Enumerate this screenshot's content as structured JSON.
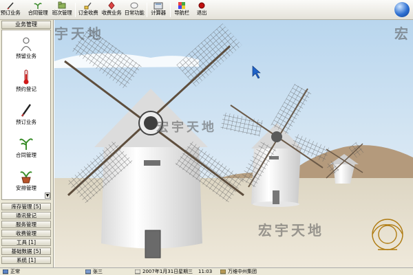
{
  "toolbar": {
    "items": [
      {
        "label": "预订业务",
        "icon": "pen-icon"
      },
      {
        "label": "合同管理",
        "icon": "plant-icon"
      },
      {
        "label": "班次管理",
        "icon": "folder-icon"
      },
      {
        "label": "订金收费",
        "icon": "payment-icon"
      },
      {
        "label": "收费业务",
        "icon": "cash-icon"
      },
      {
        "label": "日常功能",
        "icon": "balloon-icon"
      },
      {
        "label": "计算器",
        "icon": "calculator-icon"
      },
      {
        "label": "导航栏",
        "icon": "navigator-icon"
      },
      {
        "label": "退出",
        "icon": "exit-icon"
      }
    ]
  },
  "sidebar": {
    "header": "业务管理",
    "items": [
      {
        "label": "预留业务",
        "icon": "person-icon"
      },
      {
        "label": "预约登记",
        "icon": "thermometer-icon"
      },
      {
        "label": "预订业务",
        "icon": "pen-icon"
      },
      {
        "label": "合同管理",
        "icon": "plant-icon"
      },
      {
        "label": "安排管理",
        "icon": "potted-plant-icon"
      }
    ],
    "scroll_glyph": "▼",
    "modules": [
      "库存管理 [5]",
      "通讯登记",
      "服务管理",
      "收费管理",
      "工具 [1]",
      "基础数据 [5]",
      "系统 [1]"
    ]
  },
  "main": {
    "watermark": "宏宇天地",
    "watermark_right": "宏"
  },
  "statusbar": {
    "status": "正常",
    "user": "张三",
    "date": "2007年1月31日",
    "weekday": "星期三",
    "time": "11:03",
    "company": "万维中州集团"
  }
}
